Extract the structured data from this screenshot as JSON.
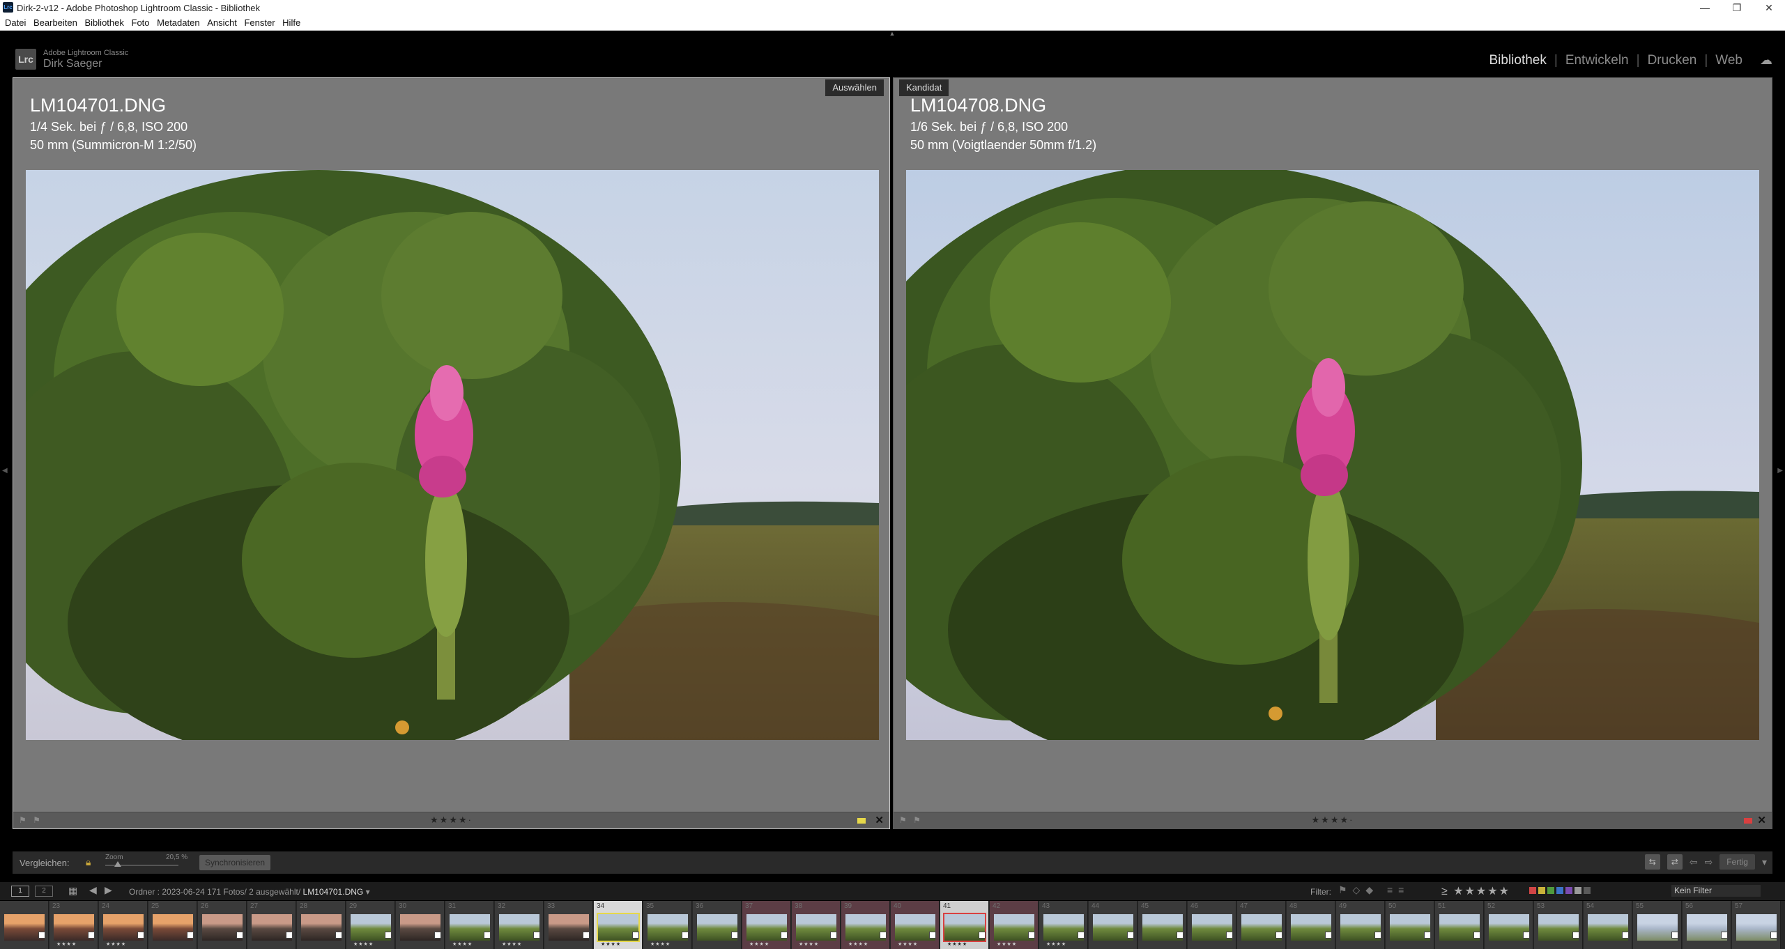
{
  "window": {
    "title": "Dirk-2-v12 - Adobe Photoshop Lightroom Classic - Bibliothek",
    "app_icon": "Lrc",
    "controls": [
      "—",
      "❐",
      "✕"
    ]
  },
  "menu": [
    "Datei",
    "Bearbeiten",
    "Bibliothek",
    "Foto",
    "Metadaten",
    "Ansicht",
    "Fenster",
    "Hilfe"
  ],
  "identity": {
    "logo": "Lrc",
    "product": "Adobe Lightroom Classic",
    "user": "Dirk Saeger"
  },
  "modules": {
    "items": [
      "Bibliothek",
      "Entwickeln",
      "Drucken",
      "Web"
    ],
    "active": "Bibliothek",
    "sep": "|"
  },
  "compare": {
    "left": {
      "badge": "Auswählen",
      "filename": "LM104701.DNG",
      "exposure": "1/4 Sek. bei ƒ / 6,8, ISO 200",
      "lens": "50 mm (Summicron-M 1:2/50)",
      "stars": "★★★★·",
      "flags": "⚑ ⚑",
      "label_color": "#e6d84a"
    },
    "right": {
      "badge": "Kandidat",
      "filename": "LM104708.DNG",
      "exposure": "1/6 Sek. bei ƒ / 6,8, ISO 200",
      "lens": "50 mm (Voigtlaender 50mm f/1.2)",
      "stars": "★★★★·",
      "flags": "⚑ ⚑",
      "label_color": "#d94040"
    },
    "close_symbol": "✕"
  },
  "toolbar": {
    "compare_label": "Vergleichen:",
    "zoom_label": "Zoom",
    "zoom_value": "20,5 %",
    "sync_button": "Synchronisieren",
    "done_button": "Fertig",
    "view_icons": [
      "⇆",
      "⇄"
    ],
    "arrow_prev": "⇦",
    "arrow_next": "⇨"
  },
  "filmstrip_header": {
    "screen1": "1",
    "screen2": "2",
    "path_prefix": "Ordner : 2023-06-24",
    "path_count": "171 Fotos/ 2 ausgewählt/",
    "path_file": "LM104701.DNG",
    "filter_label": "Filter:",
    "filter_stars": "≥ ★★★★★",
    "filter_colors": [
      "#d04545",
      "#c9b33a",
      "#4f9a3d",
      "#3c73c7",
      "#7b4bb0",
      "#9a9a9a",
      "#5a5a5a"
    ],
    "filter_preset": "Kein Filter"
  },
  "filmstrip": [
    {
      "num": "",
      "stars": "",
      "tone": "sunset"
    },
    {
      "num": "23",
      "stars": "★★★★",
      "tone": "sunset"
    },
    {
      "num": "24",
      "stars": "★★★★",
      "tone": "sunset"
    },
    {
      "num": "25",
      "stars": "",
      "tone": "sunset"
    },
    {
      "num": "26",
      "stars": "",
      "tone": "dusk"
    },
    {
      "num": "27",
      "stars": "",
      "tone": "dusk"
    },
    {
      "num": "28",
      "stars": "",
      "tone": "dusk"
    },
    {
      "num": "29",
      "stars": "★★★★",
      "tone": "green"
    },
    {
      "num": "30",
      "stars": "",
      "tone": "dusk"
    },
    {
      "num": "31",
      "stars": "★★★★",
      "tone": "green"
    },
    {
      "num": "32",
      "stars": "★★★★",
      "tone": "green"
    },
    {
      "num": "33",
      "stars": "",
      "tone": "dusk"
    },
    {
      "num": "34",
      "stars": "★★★★",
      "tone": "green",
      "sel": "A"
    },
    {
      "num": "35",
      "stars": "★★★★",
      "tone": "green"
    },
    {
      "num": "36",
      "stars": "",
      "tone": "green"
    },
    {
      "num": "37",
      "stars": "★★★★",
      "tone": "green",
      "tint": "pink"
    },
    {
      "num": "38",
      "stars": "★★★★",
      "tone": "green",
      "tint": "pink"
    },
    {
      "num": "39",
      "stars": "★★★★",
      "tone": "green",
      "tint": "pink"
    },
    {
      "num": "40",
      "stars": "★★★★",
      "tone": "green",
      "tint": "pink"
    },
    {
      "num": "41",
      "stars": "★★★★",
      "tone": "green",
      "sel": "B"
    },
    {
      "num": "42",
      "stars": "★★★★",
      "tone": "green",
      "tint": "pink"
    },
    {
      "num": "43",
      "stars": "★★★★",
      "tone": "green"
    },
    {
      "num": "44",
      "stars": "",
      "tone": "green"
    },
    {
      "num": "45",
      "stars": "",
      "tone": "green"
    },
    {
      "num": "46",
      "stars": "",
      "tone": "green"
    },
    {
      "num": "47",
      "stars": "",
      "tone": "green"
    },
    {
      "num": "48",
      "stars": "",
      "tone": "green"
    },
    {
      "num": "49",
      "stars": "",
      "tone": "green"
    },
    {
      "num": "50",
      "stars": "",
      "tone": "green"
    },
    {
      "num": "51",
      "stars": "",
      "tone": "green"
    },
    {
      "num": "52",
      "stars": "",
      "tone": "green"
    },
    {
      "num": "53",
      "stars": "",
      "tone": "green"
    },
    {
      "num": "54",
      "stars": "",
      "tone": "green"
    },
    {
      "num": "55",
      "stars": "",
      "tone": "sky"
    },
    {
      "num": "56",
      "stars": "",
      "tone": "sky"
    },
    {
      "num": "57",
      "stars": "",
      "tone": "sky"
    }
  ]
}
